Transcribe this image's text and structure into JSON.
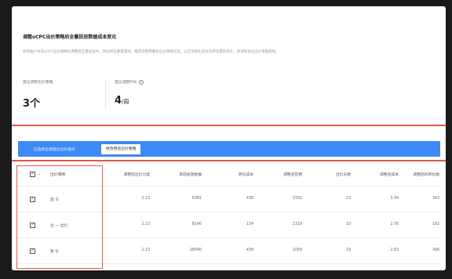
{
  "page": {
    "title": "调整oCPC出价策略后全量投放数据成本变化",
    "description": "您的账户中的oCPC出价策略在调整后全量投放中，目标转化数量增加，推荐您使用最优出价策略方案，以实现转化成本及转化量的提升，并持续优化出价策略表现。",
    "metrics": [
      {
        "label": "建议调整出价策略",
        "value": "3",
        "unit": "个"
      },
      {
        "label": "建议调整时长",
        "value": "4",
        "unit": "/周"
      }
    ]
  },
  "banner": {
    "text": "已选择全部建议出价操作",
    "button": "修改预览出价策略"
  },
  "table": {
    "headers": [
      "出价策略",
      "调整前出价力度",
      "目前投放数据",
      "转化成本",
      "调整后花费",
      "出价天数",
      "调整后成本",
      "调整后的转化数"
    ],
    "rows": [
      {
        "name": "建 价",
        "values": [
          "2.13",
          "6381",
          "438",
          "3332",
          "23",
          "3.34",
          "343"
        ]
      },
      {
        "name": "出 一 出价",
        "values": [
          "2.23",
          "8140",
          "134",
          "1319",
          "10",
          "2.76",
          "192"
        ]
      },
      {
        "name": "数 价",
        "values": [
          "2.13",
          "18040",
          "438",
          "1059",
          "19",
          "2.83",
          "396"
        ]
      }
    ]
  }
}
